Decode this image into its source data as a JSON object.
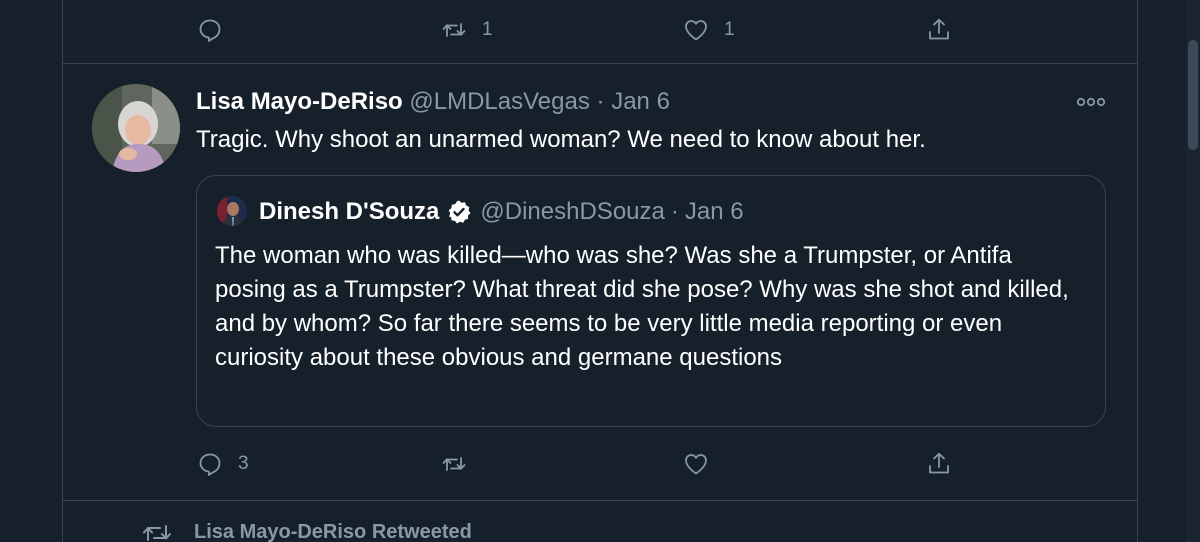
{
  "top_actions": {
    "reply_count": "",
    "retweet_count": "1",
    "like_count": "1"
  },
  "tweet": {
    "author_name": "Lisa Mayo-DeRiso",
    "handle": "@LMDLasVegas",
    "separator": "·",
    "date": "Jan 6",
    "text": "Tragic. Why shoot an unarmed woman? We need to know about her.",
    "more_icon": "more-horizontal-icon",
    "quote": {
      "author_name": "Dinesh D'Souza",
      "verified_icon": "verified-badge-icon",
      "handle": "@DineshDSouza",
      "separator": "·",
      "date": "Jan 6",
      "text": "The woman who was killed—who was she? Was she a Trumpster, or Antifa posing as a Trumpster? What threat did she pose? Why was she shot and killed, and by whom? So far there seems to be very little media reporting or even curiosity about these obvious and germane questions"
    },
    "actions": {
      "reply_count": "3",
      "retweet_count": "",
      "like_count": ""
    }
  },
  "retweeted_banner": {
    "text": "Lisa Mayo-DeRiso Retweeted",
    "icon": "retweet-icon"
  },
  "colors": {
    "background": "#15202b",
    "border": "#38444d",
    "secondary_text": "#8899a6",
    "primary_text": "#ffffff",
    "verified": "#ffffff"
  }
}
